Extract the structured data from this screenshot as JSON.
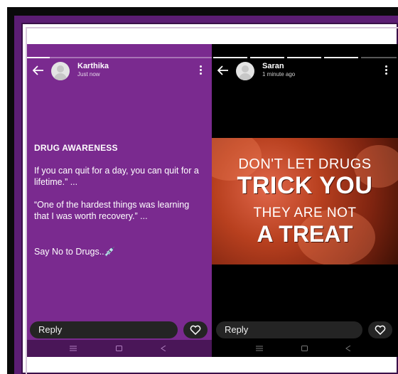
{
  "left_story": {
    "username": "Karthika",
    "time": "Just now",
    "heading": "DRUG AWARENESS",
    "paragraphs": [
      " If you can quit for a day, you can quit for a lifetime.” ...",
      "“One of the hardest things was learning that I was worth recovery.” ...",
      "Say No to Drugs..💉"
    ],
    "reply_label": "Reply",
    "background_color": "#7a2a8f"
  },
  "right_story": {
    "username": "Saran",
    "time": "1 minute ago",
    "poster": {
      "line1": "DON'T LET DRUGS",
      "line2": "TRICK YOU",
      "line3": "THEY ARE NOT",
      "line4": "A TREAT"
    },
    "reply_label": "Reply"
  },
  "icons": {
    "back": "back-arrow-icon",
    "menu": "more-vertical-icon",
    "heart": "heart-icon",
    "nav_recents": "recent-apps-icon",
    "nav_home": "home-icon",
    "nav_back": "nav-back-icon"
  }
}
